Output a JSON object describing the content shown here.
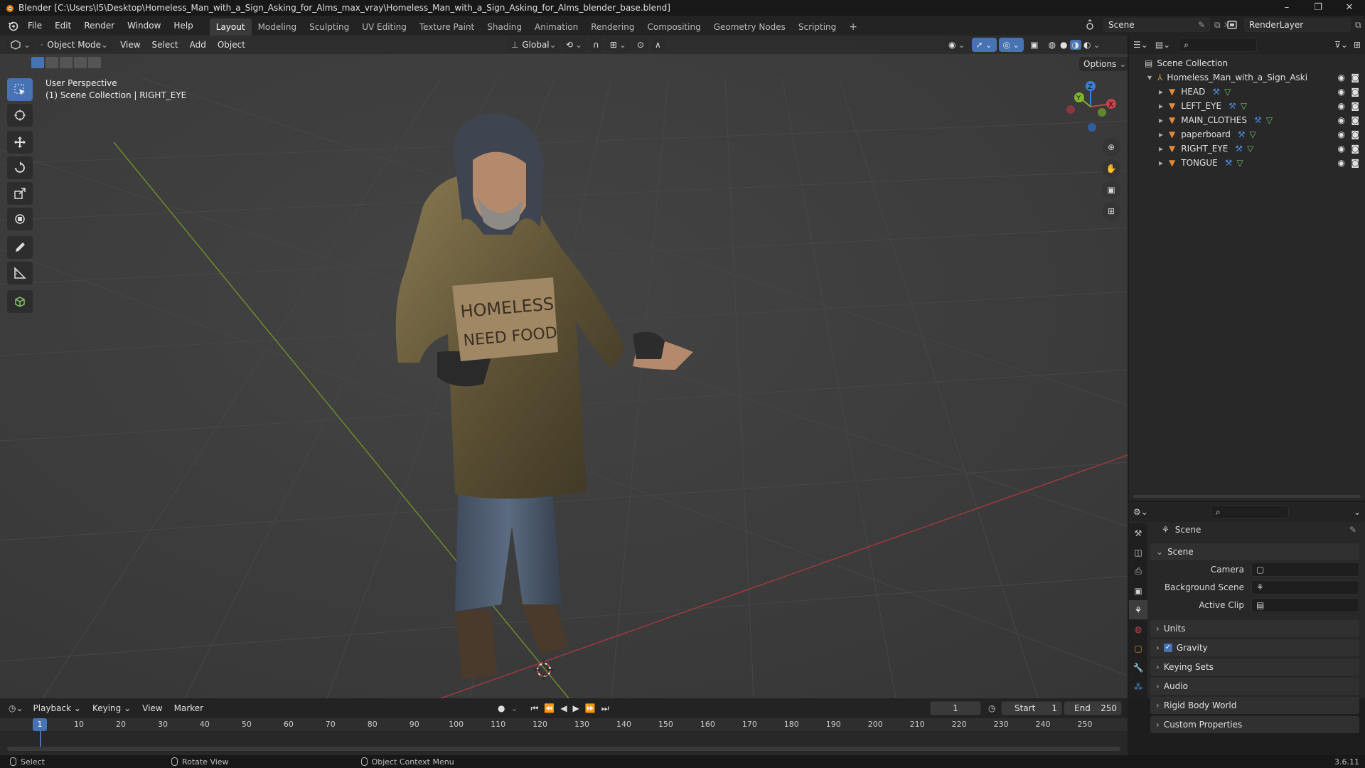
{
  "window": {
    "title": "Blender [C:\\Users\\I5\\Desktop\\Homeless_Man_with_a_Sign_Asking_for_Alms_max_vray\\Homeless_Man_with_a_Sign_Asking_for_Alms_blender_base.blend]",
    "controls": [
      "–",
      "❐",
      "✕"
    ]
  },
  "menubar": {
    "items": [
      "File",
      "Edit",
      "Render",
      "Window",
      "Help"
    ]
  },
  "workspaces": [
    "Layout",
    "Modeling",
    "Sculpting",
    "UV Editing",
    "Texture Paint",
    "Shading",
    "Animation",
    "Rendering",
    "Compositing",
    "Geometry Nodes",
    "Scripting"
  ],
  "scene": {
    "name": "Scene",
    "render_layer": "RenderLayer"
  },
  "viewport": {
    "mode": "Object Mode",
    "menus": [
      "View",
      "Select",
      "Add",
      "Object"
    ],
    "transform": "Global",
    "options": "Options",
    "perspective": "User Perspective",
    "context": "(1) Scene Collection | RIGHT_EYE",
    "sign_text": [
      "HOMELESS",
      "NEED FOOD"
    ],
    "gizmo": {
      "x": "X",
      "y": "Y",
      "z": "Z"
    }
  },
  "outliner": {
    "root": "Scene Collection",
    "collection": "Homeless_Man_with_a_Sign_Asking_for_",
    "objects": [
      "HEAD",
      "LEFT_EYE",
      "MAIN_CLOTHES",
      "paperboard",
      "RIGHT_EYE",
      "TONGUE"
    ]
  },
  "properties": {
    "header": "Scene",
    "section": "Scene",
    "fields": [
      {
        "label": "Camera",
        "value": ""
      },
      {
        "label": "Background Scene",
        "value": ""
      },
      {
        "label": "Active Clip",
        "value": ""
      }
    ],
    "panels": [
      "Units",
      "Gravity",
      "Keying Sets",
      "Audio",
      "Rigid Body World",
      "Custom Properties"
    ],
    "gravity_checked": true
  },
  "timeline": {
    "menus": [
      "Playback",
      "Keying",
      "View",
      "Marker"
    ],
    "current_frame": "1",
    "start_label": "Start",
    "start": "1",
    "end_label": "End",
    "end": "250",
    "ticks": [
      "10",
      "20",
      "30",
      "40",
      "50",
      "60",
      "70",
      "80",
      "90",
      "100",
      "110",
      "120",
      "130",
      "140",
      "150",
      "160",
      "170",
      "180",
      "190",
      "200",
      "210",
      "220",
      "230",
      "240",
      "250"
    ],
    "playhead": "1"
  },
  "statusbar": {
    "items": [
      "Select",
      "Rotate View",
      "Object Context Menu"
    ],
    "version": "3.6.11"
  },
  "colors": {
    "accent": "#4772b3",
    "x_axis": "#c2434a",
    "y_axis": "#7fb52c",
    "z_axis": "#3c7ed8",
    "object_orange": "#e08a3c"
  }
}
